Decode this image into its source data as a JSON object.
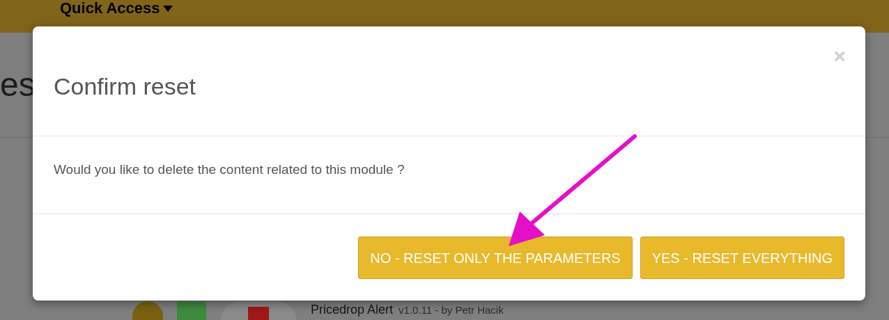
{
  "navbar": {
    "menu": "Quick Access"
  },
  "page": {
    "heading_fragment": "es",
    "module": {
      "name": "Pricedrop Alert",
      "meta": "v1.0.11 - by Petr Hacik"
    }
  },
  "dialog": {
    "title": "Confirm reset",
    "close": "×",
    "message": "Would you like to delete the content related to this module ?",
    "buttons": [
      {
        "label": "NO - RESET ONLY THE PARAMETERS"
      },
      {
        "label": "YES - RESET EVERYTHING"
      }
    ]
  }
}
